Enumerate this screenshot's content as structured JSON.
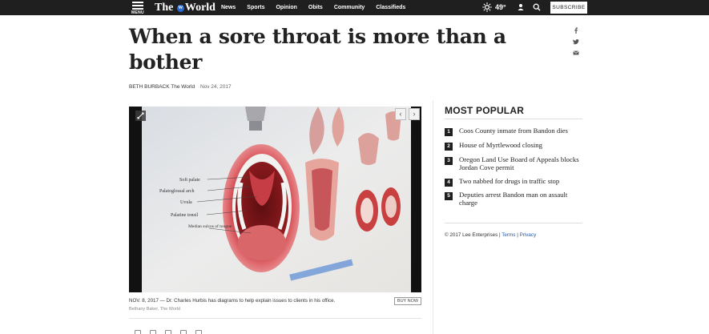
{
  "header": {
    "menu_label": "MENU",
    "brand_prefix": "The",
    "brand_mark": "W",
    "brand_suffix": "World",
    "nav": [
      "News",
      "Sports",
      "Opinion",
      "Obits",
      "Community",
      "Classifieds"
    ],
    "temperature": "49°",
    "subscribe_label": "SUBSCRIBE",
    "icons": [
      "menu-icon",
      "sun-icon",
      "user-icon",
      "search-icon"
    ]
  },
  "article": {
    "headline": "When a sore throat is more than a bother",
    "author": "BETH BURBACK The World",
    "date": "Nov 24, 2017",
    "share_icons": [
      "facebook-icon",
      "twitter-icon",
      "email-icon"
    ],
    "photo": {
      "labels": [
        "Soft palate",
        "Palatoglossal arch",
        "Uvula",
        "Palatine tonsil",
        "Median sulcus of tongue"
      ],
      "caption": "NOV. 8, 2017 — Dr. Charles Hurbis has diagrams to help explain issues to clients in his office.",
      "credit": "Bethany Baker, The World",
      "buy_label": "BUY NOW",
      "prev_glyph": "‹",
      "next_glyph": "›"
    },
    "bottom_share_icons": [
      "facebook-icon",
      "twitter-icon",
      "email-icon",
      "print-icon",
      "comment-icon"
    ]
  },
  "sidebar": {
    "title": "MOST POPULAR",
    "items": [
      {
        "num": "1",
        "text": "Coos County inmate from Bandon dies"
      },
      {
        "num": "2",
        "text": "House of Myrtlewood closing"
      },
      {
        "num": "3",
        "text": "Oregon Land Use Board of Appeals blocks Jordan Cove permit"
      },
      {
        "num": "4",
        "text": "Two nabbed for drugs in traffic stop"
      },
      {
        "num": "5",
        "text": "Deputies arrest Bandon man on assault charge"
      }
    ],
    "footer": {
      "copyright": "© 2017 Lee Enterprises",
      "sep": "|",
      "terms": "Terms",
      "privacy": "Privacy"
    }
  },
  "colors": {
    "topbar": "#1f1f1f",
    "brand_mark": "#2a6ad3",
    "link": "#1a5bb3"
  }
}
